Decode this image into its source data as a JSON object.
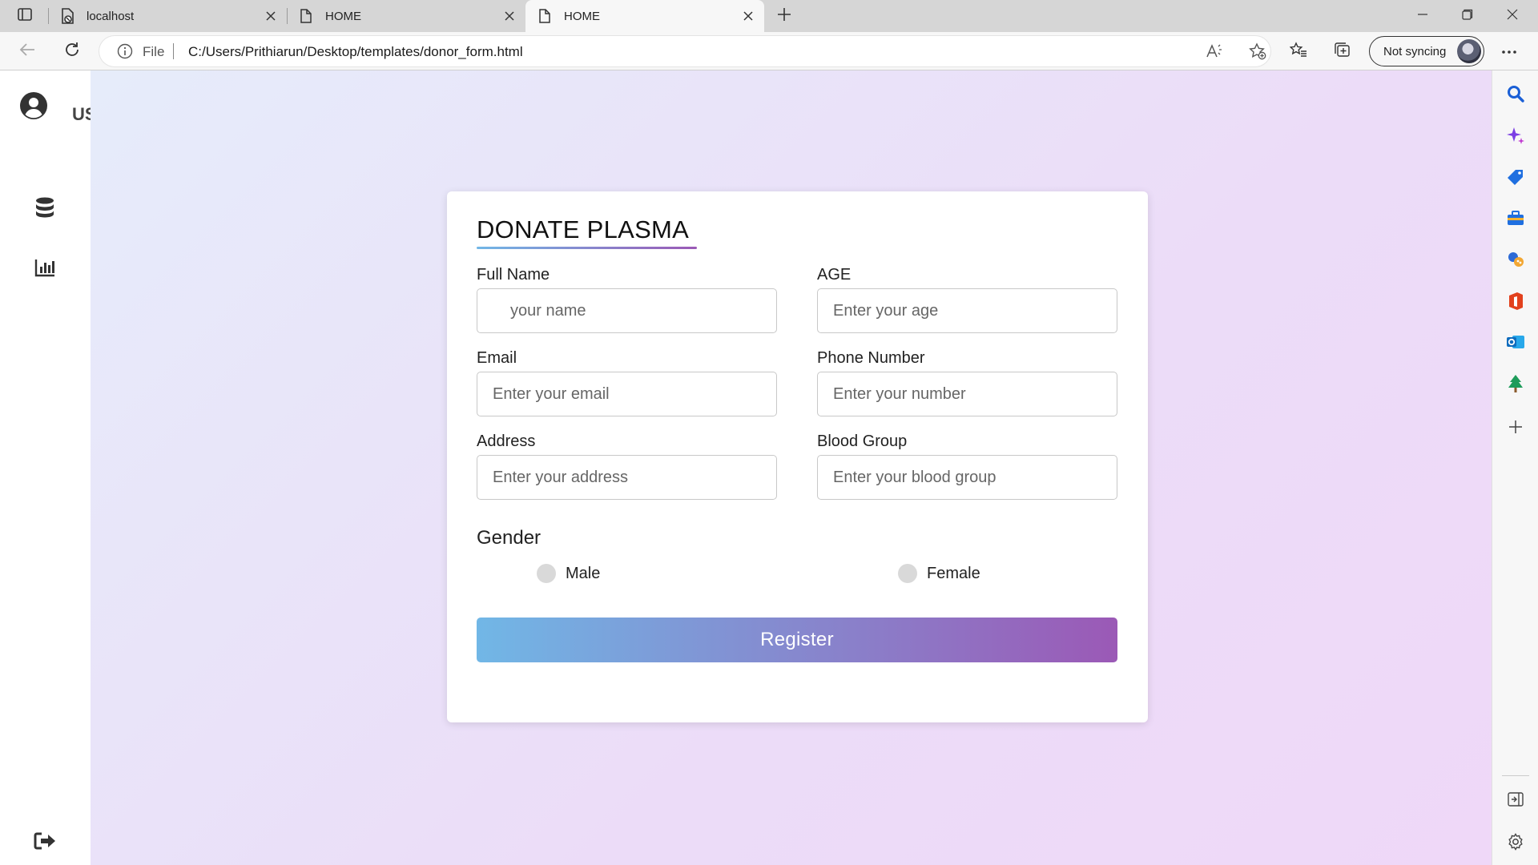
{
  "browser": {
    "tabs": [
      {
        "title": "localhost",
        "active": false
      },
      {
        "title": "HOME",
        "active": false
      },
      {
        "title": "HOME",
        "active": true
      }
    ],
    "address": {
      "scheme_label": "File",
      "url": "C:/Users/Prithiarun/Desktop/templates/donor_form.html"
    },
    "profile": {
      "sync_label": "Not syncing"
    }
  },
  "sidebar": {
    "user_label": "USER",
    "icons": [
      "user-circle-icon",
      "database-icon",
      "bar-chart-icon",
      "logout-icon"
    ]
  },
  "form": {
    "title": "DONATE PLASMA",
    "fields": [
      {
        "label": "Full Name",
        "placeholder": "your name",
        "value": ""
      },
      {
        "label": "AGE",
        "placeholder": "Enter your age",
        "value": ""
      },
      {
        "label": "Email",
        "placeholder": "Enter your email",
        "value": ""
      },
      {
        "label": "Phone Number",
        "placeholder": "Enter your number",
        "value": ""
      },
      {
        "label": "Address",
        "placeholder": "Enter your address",
        "value": ""
      },
      {
        "label": "Blood Group",
        "placeholder": "Enter your blood group",
        "value": ""
      }
    ],
    "gender": {
      "label": "Gender",
      "options": [
        {
          "label": "Male",
          "selected": false
        },
        {
          "label": "Female",
          "selected": false
        }
      ]
    },
    "submit_label": "Register"
  },
  "colors": {
    "gradient_start": "#71b7e6",
    "gradient_end": "#9b59b6",
    "page_bg_start": "#e6ecfa",
    "page_bg_end": "#efd8f8"
  }
}
